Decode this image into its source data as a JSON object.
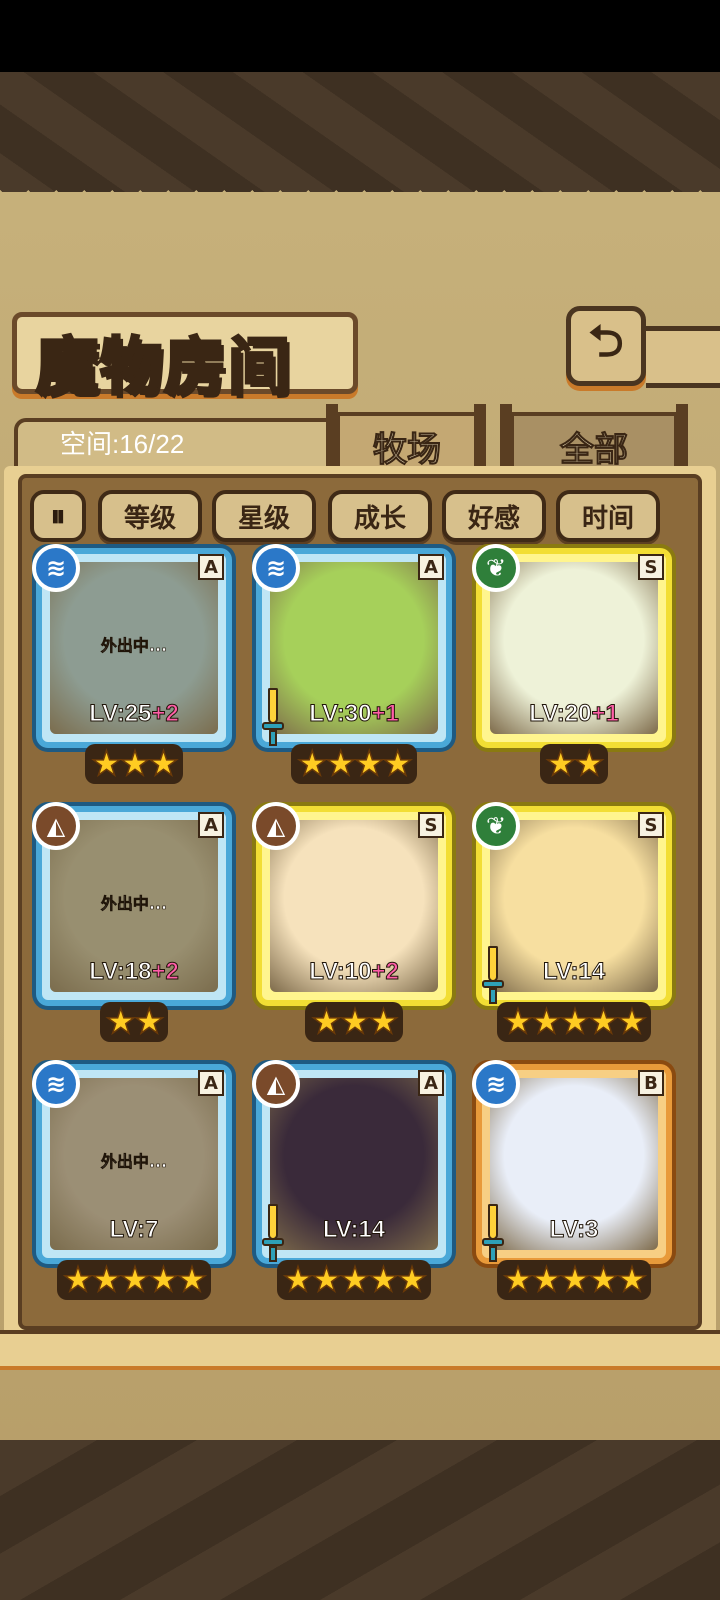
{
  "header": {
    "title": "魔物房间",
    "back_icon": "return-arrow-icon"
  },
  "storage": {
    "label": "空间:16/22"
  },
  "tabs": [
    {
      "label": "牧场",
      "active": true
    },
    {
      "label": "全部",
      "active": false
    }
  ],
  "filters": {
    "toggle_icon": "sort-toggle-icon",
    "buttons": [
      "等级",
      "星级",
      "成长",
      "好感",
      "时间"
    ]
  },
  "elements": {
    "water": "≋",
    "leaf": "❦",
    "earth": "◭"
  },
  "colors": {
    "frame_blue": "#4aa8d8",
    "frame_yellow": "#f2de34",
    "frame_orange": "#e89a3a",
    "level_plus": "#ff5ea8",
    "star": "#ffcc22"
  },
  "monsters": [
    {
      "element": "water",
      "rank": "A",
      "level": "LV:25",
      "bonus": "+2",
      "stars": "★★★",
      "status": "外出中...",
      "frame": "blue",
      "portrait_color": "#9fc2c8"
    },
    {
      "element": "water",
      "rank": "A",
      "level": "LV:30",
      "bonus": "+1",
      "stars": "★★★★",
      "status": "",
      "frame": "blue",
      "portrait_color": "#a6d05a"
    },
    {
      "element": "leaf",
      "rank": "S",
      "level": "LV:20",
      "bonus": "+1",
      "stars": "★★",
      "status": "",
      "frame": "yellow",
      "portrait_color": "#eef2d8"
    },
    {
      "element": "earth",
      "rank": "A",
      "level": "LV:18",
      "bonus": "+2",
      "stars": "★★",
      "status": "外出中...",
      "frame": "blue",
      "portrait_color": "#b3a98a"
    },
    {
      "element": "earth",
      "rank": "S",
      "level": "LV:10",
      "bonus": "+2",
      "stars": "★★★",
      "status": "",
      "frame": "yellow",
      "portrait_color": "#f6e2bc"
    },
    {
      "element": "leaf",
      "rank": "S",
      "level": "LV:14",
      "bonus": "",
      "stars": "★★★★★",
      "status": "",
      "frame": "yellow",
      "portrait_color": "#f7dfa0"
    },
    {
      "element": "water",
      "rank": "A",
      "level": "LV:7",
      "bonus": "",
      "stars": "★★★★★",
      "status": "外出中...",
      "frame": "blue",
      "portrait_color": "#b9a994"
    },
    {
      "element": "earth",
      "rank": "A",
      "level": "LV:14",
      "bonus": "",
      "stars": "★★★★★",
      "status": "",
      "frame": "blue",
      "portrait_color": "#3a2a3a"
    },
    {
      "element": "water",
      "rank": "B",
      "level": "LV:3",
      "bonus": "",
      "stars": "★★★★★",
      "status": "",
      "frame": "orange",
      "portrait_color": "#e9eef8"
    }
  ]
}
